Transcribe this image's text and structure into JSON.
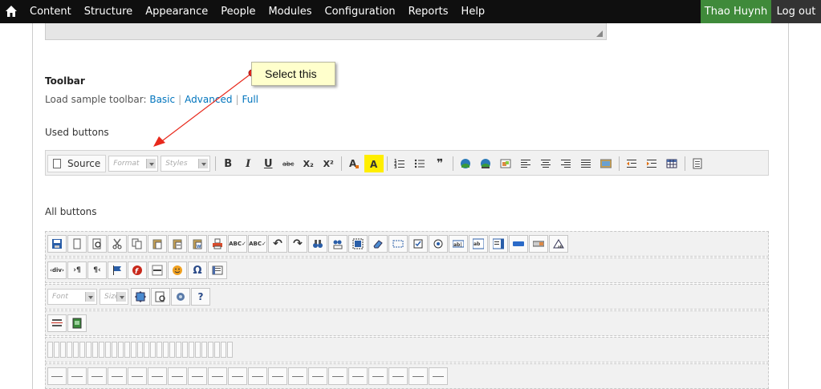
{
  "admin_bar": {
    "menu": [
      "Content",
      "Structure",
      "Appearance",
      "People",
      "Modules",
      "Configuration",
      "Reports",
      "Help"
    ],
    "user": "Thao Huynh",
    "logout": "Log out",
    "user_color": "#3f8a3a"
  },
  "toolbar_section": {
    "title": "Toolbar",
    "sample_prefix": "Load sample toolbar:",
    "sample_basic": "Basic",
    "sample_advanced": "Advanced",
    "sample_full": "Full",
    "used_label": "Used buttons",
    "all_label": "All buttons"
  },
  "used_toolbar": {
    "source_label": "Source",
    "format_placeholder": "Format",
    "styles_placeholder": "Styles",
    "bold": "B",
    "italic": "I",
    "underline": "U",
    "strike": "abc",
    "subscript": "X₂",
    "superscript": "X²"
  },
  "all_toolbar": {
    "font_placeholder": "Font",
    "size_placeholder": "Size"
  },
  "callout": {
    "text": "Select this",
    "arrow_color": "#e8291c"
  }
}
